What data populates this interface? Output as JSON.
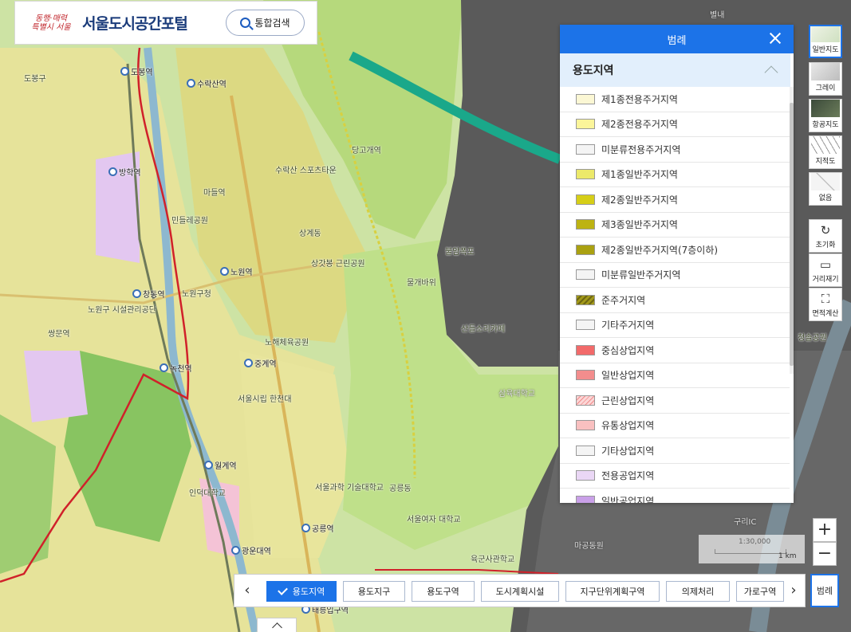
{
  "colors": {
    "primary": "#1c73e8",
    "legend_section_bg": "#e2effc"
  },
  "header": {
    "logo_text_line1": "동행·매력",
    "logo_text_line2": "특별시 서울",
    "title": "서울도시공간포털",
    "search_label": "통합검색"
  },
  "legend": {
    "title": "범례",
    "section": "용도지역",
    "items": [
      {
        "label": "제1종전용주거지역",
        "color": "#fbf7d4"
      },
      {
        "label": "제2종전용주거지역",
        "color": "#fbf59a"
      },
      {
        "label": "미분류전용주거지역",
        "color": "#f4f4f4"
      },
      {
        "label": "제1종일반주거지역",
        "color": "#ece96a"
      },
      {
        "label": "제2종일반주거지역",
        "color": "#d6ce17"
      },
      {
        "label": "제3종일반주거지역",
        "color": "#bdb313"
      },
      {
        "label": "제2종일반주거지역(7층이하)",
        "color": "#aaa111"
      },
      {
        "label": "미분류일반주거지역",
        "color": "#f4f4f4"
      },
      {
        "label": "준주거지역",
        "color": "hatch-dark"
      },
      {
        "label": "기타주거지역",
        "color": "#f4f4f4"
      },
      {
        "label": "중심상업지역",
        "color": "#f26a6a"
      },
      {
        "label": "일반상업지역",
        "color": "#f38d8d"
      },
      {
        "label": "근린상업지역",
        "color": "hatch-red"
      },
      {
        "label": "유통상업지역",
        "color": "#f9c0c0"
      },
      {
        "label": "기타상업지역",
        "color": "#f4f4f4"
      },
      {
        "label": "전용공업지역",
        "color": "#ead7f5"
      },
      {
        "label": "일반공업지역",
        "color": "#c9a0e8"
      }
    ]
  },
  "toolbar": {
    "basemaps": [
      {
        "label": "일반지도",
        "icon": "general-map-icon",
        "active": true
      },
      {
        "label": "그레이",
        "icon": "gray-map-icon",
        "active": false
      },
      {
        "label": "항공지도",
        "icon": "aerial-map-icon",
        "active": false
      },
      {
        "label": "지적도",
        "icon": "cadastral-map-icon",
        "active": false
      },
      {
        "label": "없음",
        "icon": "none-map-icon",
        "active": false
      }
    ],
    "tools": [
      {
        "label": "초기화",
        "icon": "reset-icon"
      },
      {
        "label": "거리재기",
        "icon": "ruler-icon"
      },
      {
        "label": "면적계산",
        "icon": "area-icon"
      }
    ],
    "zoom_in": "+",
    "zoom_out": "−"
  },
  "scale": {
    "ratio": "1:30,000",
    "distance": "1 km"
  },
  "tabs": [
    {
      "label": "용도지역",
      "active": true
    },
    {
      "label": "용도지구",
      "active": false
    },
    {
      "label": "용도구역",
      "active": false
    },
    {
      "label": "도시계획시설",
      "active": false
    },
    {
      "label": "지구단위계획구역",
      "active": false
    },
    {
      "label": "의제처리",
      "active": false
    },
    {
      "label": "가로구역",
      "active": false
    }
  ],
  "legend_toggle": "범례",
  "map": {
    "stations": [
      "도봉역",
      "방학역",
      "창동역",
      "노원역",
      "수락산역",
      "녹천역",
      "중계역",
      "월계역",
      "광운대역",
      "태릉입구역",
      "공릉역"
    ],
    "places": [
      "수락산 스포츠타운",
      "민들레공원",
      "당고개역",
      "상계동",
      "노원구청",
      "노원구 시설관리공단",
      "불암폭포",
      "물개바위",
      "산들소리카페",
      "노해체육공원",
      "상갓봉 근린공원",
      "삼육대학교",
      "서울시립 한천대",
      "마들역",
      "서울과학 기술대학교",
      "서울여자 대학교",
      "공릉동",
      "육군사관학교",
      "인덕대학교",
      "마공동원",
      "도봉구",
      "쌍문역",
      "구리IC",
      "별내",
      "청솔공원"
    ]
  }
}
